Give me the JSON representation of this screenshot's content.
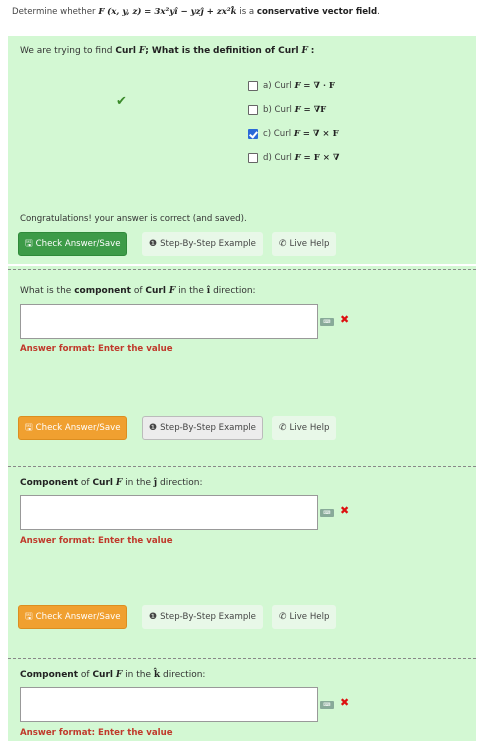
{
  "header": {
    "prefix": "Determine whether",
    "vec_f": "F",
    "args": "(x, y, z)",
    "equation": "= 3x²yî − yzĵ + zx²k̂",
    "mid": "is a",
    "emph": "conservative vector field",
    "suffix": "."
  },
  "q1": {
    "lead": "We are trying to find",
    "curl": "Curl",
    "vec": "F",
    "mid": "; What is the",
    "emph": "definition of Curl",
    "tail": ":",
    "options": [
      {
        "label": "a) Curl",
        "formula": "= ∇ · F",
        "checked": false
      },
      {
        "label": "b) Curl",
        "formula": "= ∇F",
        "checked": false
      },
      {
        "label": "c) Curl",
        "formula": "= ∇ × F",
        "checked": true
      },
      {
        "label": "d) Curl",
        "formula": "= F × ∇",
        "checked": false
      }
    ],
    "message": "Congratulations! your answer is correct (and saved).",
    "check_label": "Check Answer/Save",
    "example_label": "Step-By-Step Example",
    "help_label": "Live Help"
  },
  "q2": {
    "lead": "What is the",
    "emph": "component",
    "mid": "of",
    "curl": "Curl",
    "vec": "F",
    "tail_a": "in the",
    "unit": "î",
    "tail_b": "direction:",
    "input_value": "",
    "format": "Answer format: Enter the value",
    "check_label": "Check Answer/Save",
    "example_label": "Step-By-Step Example",
    "help_label": "Live Help"
  },
  "q3": {
    "emph": "Component",
    "mid": "of",
    "curl": "Curl",
    "vec": "F",
    "tail_a": "in the",
    "unit": "ĵ",
    "tail_b": "direction:",
    "input_value": "",
    "format": "Answer format: Enter the value",
    "check_label": "Check Answer/Save",
    "example_label": "Step-By-Step Example",
    "help_label": "Live Help"
  },
  "q4": {
    "emph": "Component",
    "mid": "of",
    "curl": "Curl",
    "vec": "F",
    "tail_a": "in the",
    "unit": "k̂",
    "tail_b": "direction:",
    "input_value": "",
    "format": "Answer format: Enter the value"
  },
  "colors": {
    "panel": "#d3f8d3",
    "check_green": "#3d9b48",
    "check_orange": "#f0a030",
    "error": "#d11"
  }
}
